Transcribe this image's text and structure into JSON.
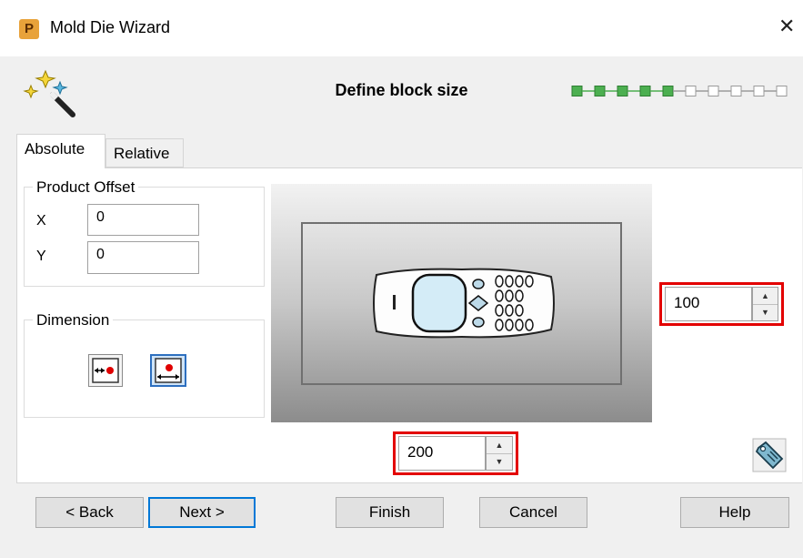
{
  "window": {
    "title": "Mold Die Wizard",
    "app_icon_letter": "P",
    "close_glyph": "✕"
  },
  "header": {
    "title": "Define block size",
    "progress": {
      "completed_steps": 5,
      "total_steps": 10,
      "done_color": "#4caf50"
    }
  },
  "tabs": [
    {
      "label": "Absolute",
      "active": true
    },
    {
      "label": "Relative",
      "active": false
    }
  ],
  "product_offset": {
    "legend": "Product Offset",
    "x": {
      "label": "X",
      "value": "0"
    },
    "y": {
      "label": "Y",
      "value": "0"
    }
  },
  "dimension": {
    "legend": "Dimension",
    "selected_mode": "width-arrows"
  },
  "block": {
    "height_value": "100",
    "width_value": "200"
  },
  "icons": {
    "wizard": "magic-wand-icon",
    "settings": "tag-settings-icon"
  },
  "buttons": {
    "back": "< Back",
    "next": "Next >",
    "finish": "Finish",
    "cancel": "Cancel",
    "help": "Help"
  },
  "colors": {
    "highlight": "#e30000",
    "accent": "#0078d7"
  }
}
